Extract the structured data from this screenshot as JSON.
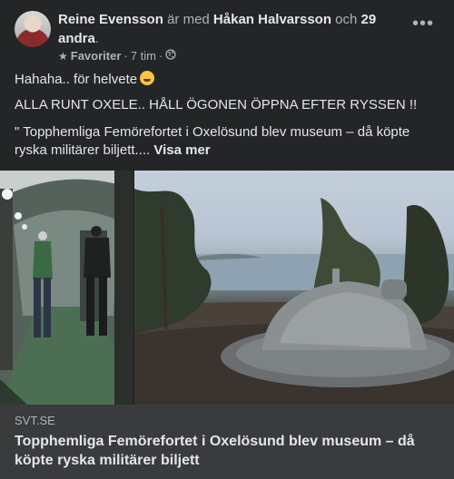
{
  "header": {
    "author": "Reine Evensson",
    "with_text": "är med",
    "tagged": "Håkan Halvarsson",
    "and_text": "och",
    "others": "29 andra",
    "period": ".",
    "audience": "Favoriter",
    "separator": "·",
    "time": "7 tim",
    "separator2": "·"
  },
  "body": {
    "line1": "Hahaha.. för helvete",
    "line2": "ALLA RUNT OXELE.. HÅLL ÖGONEN ÖPPNA EFTER RYSSEN !!",
    "line3": "\" Topphemliga Femörefortet i Oxelösund blev museum – då köpte ryska militärer biljett....",
    "see_more": "Visa mer"
  },
  "link": {
    "domain": "SVT.SE",
    "title": "Topphemliga Femörefortet i Oxelösund blev museum – då köpte ryska militärer biljett"
  }
}
